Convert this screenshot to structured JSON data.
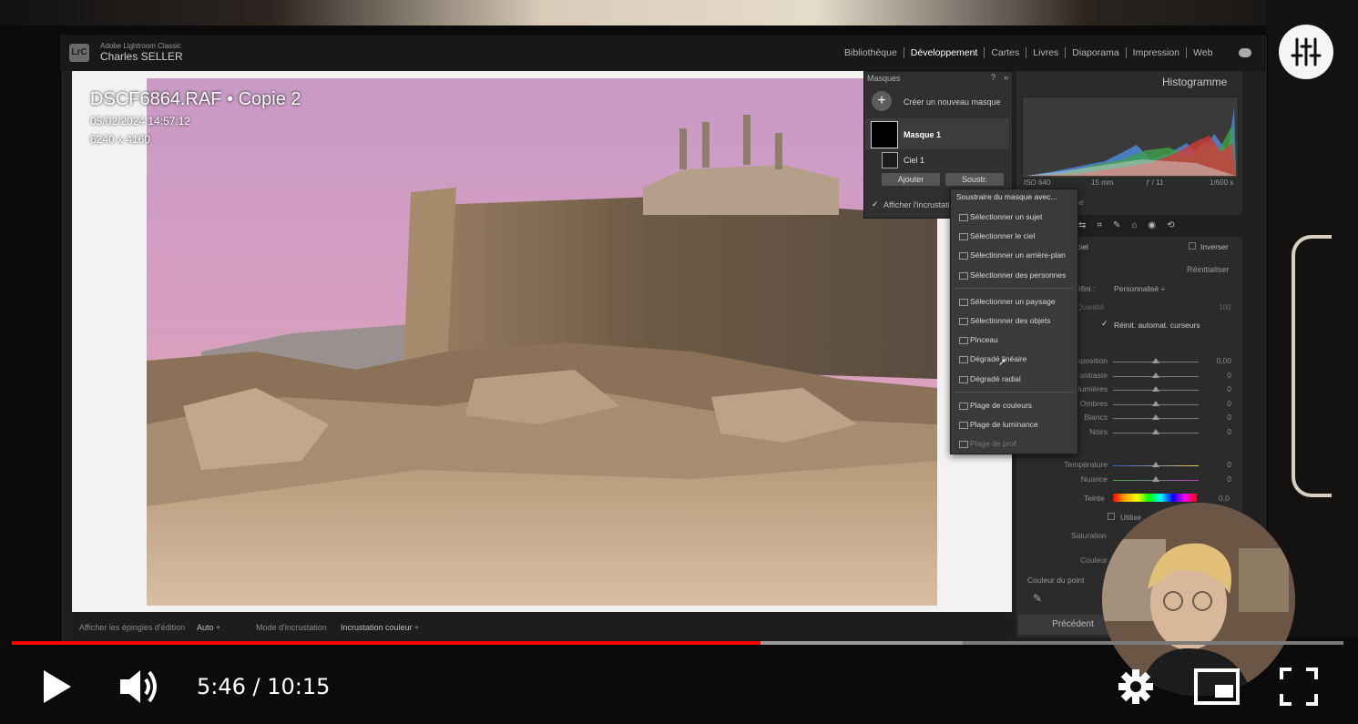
{
  "lightroom": {
    "app_name": "Adobe Lightroom Classic",
    "user": "Charles SELLER",
    "logo": "LrC",
    "modules": [
      "Bibliothèque",
      "Développement",
      "Cartes",
      "Livres",
      "Diaporama",
      "Impression",
      "Web"
    ],
    "active_module": "Développement"
  },
  "photo": {
    "filename": "DSCF6864.RAF  •  Copie 2",
    "date": "05/02/2024 14:57:12",
    "dimensions": "6240 x 4160"
  },
  "bottom_bar": {
    "pins_label": "Afficher les épingles d'édition",
    "pins_value": "Auto ÷",
    "overlay_mode_label": "Mode d'incrustation",
    "overlay_mode_value": "Incrustation couleur ÷"
  },
  "masks_panel": {
    "title": "Masques",
    "new_mask": "Créer un nouveau masque",
    "mask_name": "Masque 1",
    "sub_mask": "Ciel 1",
    "add_button": "Ajouter",
    "subtract_button": "Soustr.",
    "show_overlay": "Afficher l'incrustation"
  },
  "dropdown": {
    "header": "Soustraire du masque avec...",
    "groups": [
      [
        "Sélectionner un sujet",
        "Sélectionner le ciel",
        "Sélectionner un arrière-plan",
        "Sélectionner des personnes"
      ],
      [
        "Sélectionner un paysage",
        "Sélectionner des objets",
        "Pinceau",
        "Dégradé linéaire",
        "Dégradé radial"
      ],
      [
        "Plage de couleurs",
        "Plage de luminance",
        "Plage de prof."
      ]
    ]
  },
  "right_panel": {
    "histogram_title": "Histogramme",
    "meta": [
      "ISO 640",
      "15 mm",
      "ƒ / 11",
      "1/600 s"
    ],
    "tool_fragment": "ne",
    "ciel_fragment": "ciel",
    "invert": "Inverser",
    "reset": "Réinitialiser",
    "preset_fragment": "éfini :",
    "preset_value": "Personnalisé ÷",
    "amount_label": "Quantité",
    "amount_value": "100",
    "auto_reset": "Réinit. automat. curseurs",
    "sliders": [
      {
        "label": "xposition",
        "value": "0,00"
      },
      {
        "label": "ontraste",
        "value": "0"
      },
      {
        "label": "lumières",
        "value": "0"
      },
      {
        "label": "Ombres",
        "value": "0"
      },
      {
        "label": "Blancs",
        "value": "0"
      },
      {
        "label": "Noirs",
        "value": "0"
      }
    ],
    "color_section": "ouleur",
    "color_sliders": [
      {
        "label": "Température",
        "value": "0"
      },
      {
        "label": "Nuance",
        "value": "0"
      }
    ],
    "hue_label": "Teinte",
    "hue_value": "0,0",
    "use_fragment": "Utilise",
    "saturation": "Saturation",
    "couleur": "Couleur",
    "point_color": "Couleur du point",
    "previous": "Précédent"
  },
  "player": {
    "time": "5:46 / 10:15",
    "progress_played": 0.562,
    "progress_buffered": 0.714
  }
}
